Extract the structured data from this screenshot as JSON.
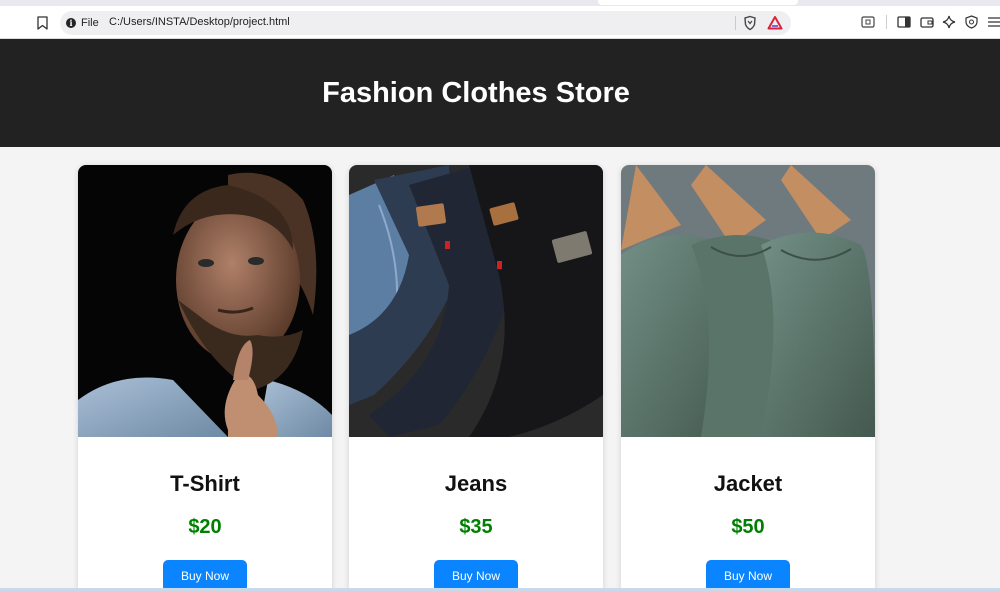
{
  "browser": {
    "site_info_label": "File",
    "url": "C:/Users/INSTA/Desktop/project.html",
    "icons": [
      "bookmark-icon",
      "info-icon",
      "brave-shield-icon",
      "brave-rewards-icon",
      "screenshot-icon",
      "sidebar-icon",
      "wallet-icon",
      "leo-ai-icon",
      "vpn-icon",
      "menu-icon"
    ]
  },
  "header": {
    "title": "Fashion Clothes Store",
    "background": "#222222"
  },
  "products": [
    {
      "name": "T-Shirt",
      "price": "$20",
      "button_label": "Buy Now"
    },
    {
      "name": "Jeans",
      "price": "$35",
      "button_label": "Buy Now"
    },
    {
      "name": "Jacket",
      "price": "$50",
      "button_label": "Buy Now"
    }
  ],
  "colors": {
    "price": "#008000",
    "button": "#0b84ff",
    "page_background": "#f4f4f4"
  }
}
